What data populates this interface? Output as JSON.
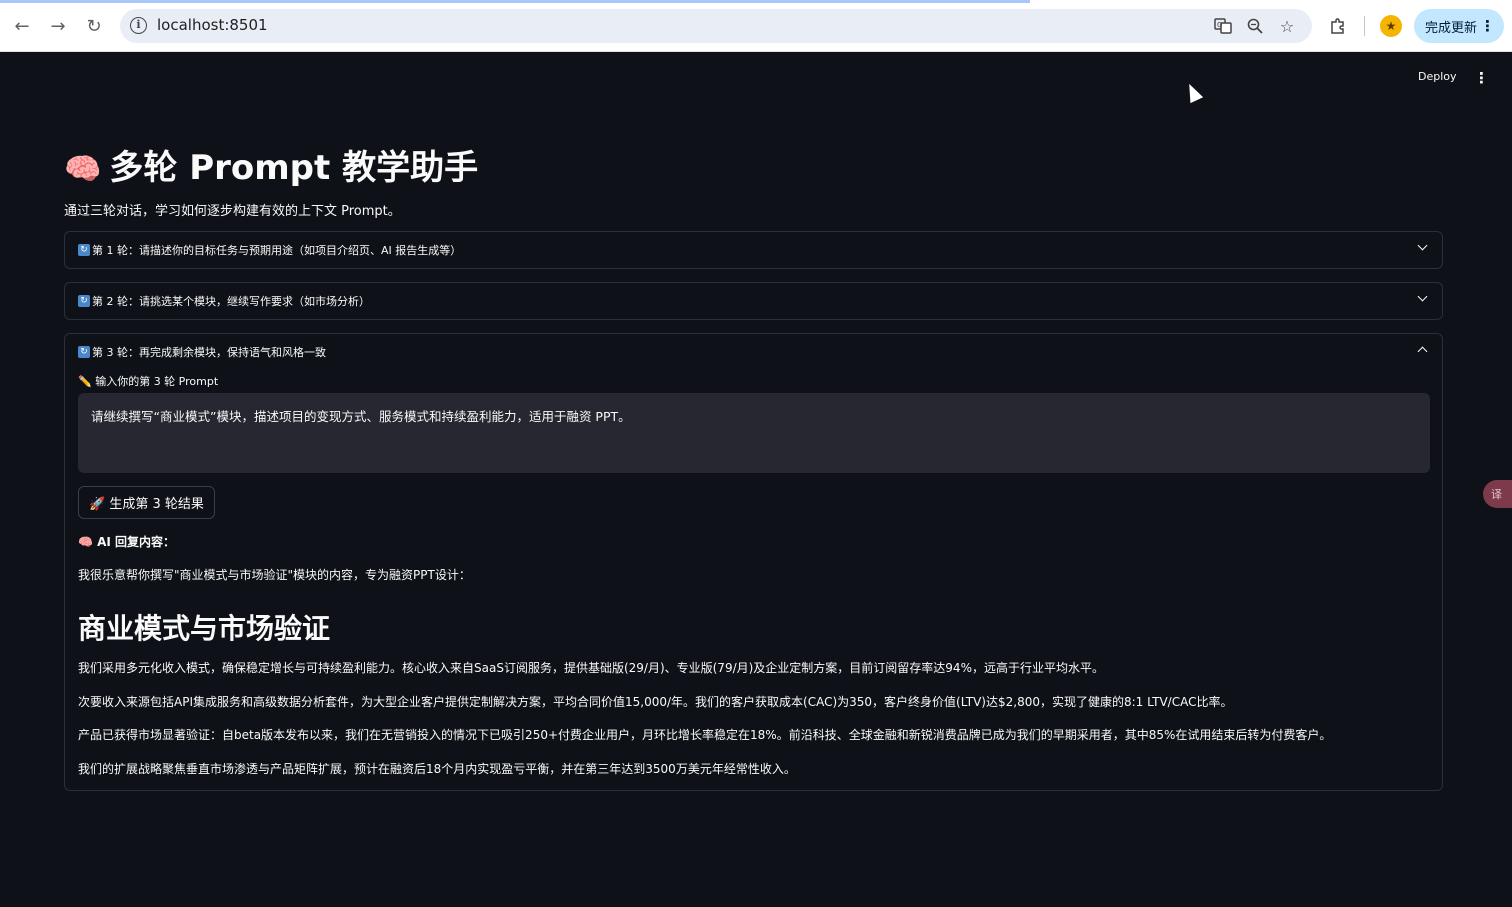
{
  "browser": {
    "url": "localhost:8501",
    "update_button": "完成更新"
  },
  "header": {
    "deploy_label": "Deploy"
  },
  "page": {
    "title_icon": "🧠",
    "title": "多轮 Prompt 教学助手",
    "subtitle": "通过三轮对话，学习如何逐步构建有效的上下文 Prompt。"
  },
  "expanders": [
    {
      "label": "第 1 轮：请描述你的目标任务与预期用途（如项目介绍页、AI 报告生成等）",
      "state": "collapsed"
    },
    {
      "label": "第 2 轮：请挑选某个模块，继续写作要求（如市场分析）",
      "state": "collapsed"
    },
    {
      "label": "第 3 轮：再完成剩余模块，保持语气和风格一致",
      "state": "expanded"
    }
  ],
  "round3": {
    "input_label": "✏️ 输入你的第 3 轮 Prompt",
    "input_value": "请继续撰写“商业模式”模块，描述项目的变现方式、服务模式和持续盈利能力，适用于融资 PPT。",
    "generate_button": "🚀 生成第 3 轮结果",
    "ai_label": "🧠 AI 回复内容：",
    "response_intro": "我很乐意帮你撰写\"商业模式与市场验证\"模块的内容，专为融资PPT设计：",
    "response_heading": "商业模式与市场验证",
    "paragraphs": [
      "我们采用多元化收入模式，确保稳定增长与可持续盈利能力。核心收入来自SaaS订阅服务，提供基础版(29/月)、专业版(79/月)及企业定制方案，目前订阅留存率达94%，远高于行业平均水平。",
      "次要收入来源包括API集成服务和高级数据分析套件，为大型企业客户提供定制解决方案，平均合同价值15,000/年。我们的客户获取成本(CAC)为350，客户终身价值(LTV)达$2,800，实现了健康的8:1 LTV/CAC比率。",
      "产品已获得市场显著验证：自beta版本发布以来，我们在无营销投入的情况下已吸引250+付费企业用户，月环比增长率稳定在18%。前沿科技、全球金融和新锐消费品牌已成为我们的早期采用者，其中85%在试用结束后转为付费客户。",
      "我们的扩展战略聚焦垂直市场渗透与产品矩阵扩展，预计在融资后18个月内实现盈亏平衡，并在第三年达到3500万美元年经常性收入。"
    ]
  },
  "icons": {
    "back": "arrow-left-icon",
    "forward": "arrow-right-icon",
    "reload": "reload-icon",
    "info": "info-icon",
    "translate": "translate-icon",
    "zoom": "zoom-icon",
    "star": "star-icon",
    "extensions": "puzzle-icon",
    "menu": "kebab-menu-icon"
  }
}
